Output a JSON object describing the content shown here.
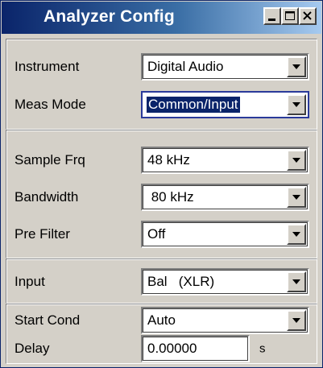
{
  "window": {
    "title": "Analyzer Config",
    "controls": {
      "minimize": "minimize-icon",
      "maximize": "maximize-icon",
      "close": "close-icon"
    }
  },
  "groups": [
    {
      "rows": [
        {
          "label": "Instrument",
          "value": "Digital Audio"
        },
        {
          "label": "Meas Mode",
          "value": "Common/Input"
        }
      ]
    },
    {
      "rows": [
        {
          "label": "Sample Frq",
          "value": "48 kHz"
        },
        {
          "label": "Bandwidth",
          "value": " 80 kHz"
        },
        {
          "label": "Pre Filter",
          "value": "Off"
        }
      ]
    },
    {
      "rows": [
        {
          "label": "Input",
          "value": "Bal   (XLR)"
        }
      ]
    },
    {
      "rows": [
        {
          "label": "Start Cond",
          "value": "Auto"
        },
        {
          "label": "Delay",
          "value": "0.00000",
          "unit": "s"
        }
      ]
    }
  ],
  "colors": {
    "titlebar_start": "#0a246a",
    "titlebar_end": "#a6caf0",
    "face": "#d4d0c8",
    "focus_border": "#2a3a9a",
    "selection": "#0a246a"
  }
}
